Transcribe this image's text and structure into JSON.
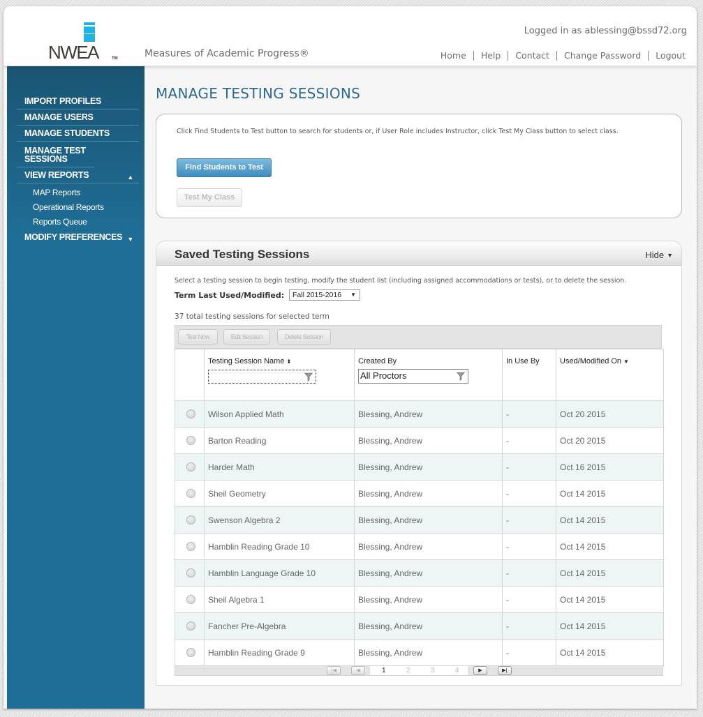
{
  "header": {
    "logo_text": "NWEA",
    "logo_tm": "TM",
    "app_title": "Measures of Academic Progress®",
    "logged_in": "Logged in as ablessing@bssd72.org",
    "nav": [
      "Home",
      "Help",
      "Contact",
      "Change Password",
      "Logout"
    ]
  },
  "sidebar": {
    "items": [
      {
        "label": "IMPORT PROFILES"
      },
      {
        "label": "MANAGE USERS"
      },
      {
        "label": "MANAGE STUDENTS"
      },
      {
        "label": "MANAGE TEST SESSIONS"
      },
      {
        "label": "VIEW REPORTS",
        "expanded": true
      },
      {
        "label": "MODIFY PREFERENCES",
        "expanded": false
      }
    ],
    "sub_items": [
      "MAP Reports",
      "Operational Reports",
      "Reports Queue"
    ],
    "colors": {
      "top": "#1a5573",
      "bottom": "#1f6e97"
    }
  },
  "main": {
    "page_title": "MANAGE TESTING SESSIONS",
    "instructions": "Click Find Students to Test button to search for students or, if User Role includes Instructor, click Test My Class button to select class.",
    "find_button": "Find Students to Test",
    "test_my_class_button": "Test My Class",
    "accent_color": "#3f8dbd"
  },
  "saved": {
    "title": "Saved Testing Sessions",
    "hide_label": "Hide",
    "instructions": "Select a testing session to begin testing, modify the student list (including assigned accommodations or tests), or to delete the session.",
    "term_label": "Term Last Used/Modified:",
    "term_value": "Fall 2015-2016",
    "total_text": "37 total testing sessions for selected term",
    "toolbar": {
      "test_now": "Test Now",
      "edit_session": "Edit Session",
      "delete_session": "Delete Session"
    },
    "columns": [
      "Testing Session Name",
      "Created By",
      "In Use By",
      "Used/Modified On"
    ],
    "name_filter_value": "",
    "created_by_filter": "All Proctors",
    "rows": [
      {
        "name": "Wilson Applied Math",
        "created_by": "Blessing, Andrew",
        "in_use_by": "-",
        "modified": "Oct 20 2015"
      },
      {
        "name": "Barton Reading",
        "created_by": "Blessing, Andrew",
        "in_use_by": "-",
        "modified": "Oct 20 2015"
      },
      {
        "name": "Harder Math",
        "created_by": "Blessing, Andrew",
        "in_use_by": "-",
        "modified": "Oct 16 2015"
      },
      {
        "name": "Sheil Geometry",
        "created_by": "Blessing, Andrew",
        "in_use_by": "-",
        "modified": "Oct 14 2015"
      },
      {
        "name": "Swenson Algebra 2",
        "created_by": "Blessing, Andrew",
        "in_use_by": "-",
        "modified": "Oct 14 2015"
      },
      {
        "name": "Hamblin Reading Grade 10",
        "created_by": "Blessing, Andrew",
        "in_use_by": "-",
        "modified": "Oct 14 2015"
      },
      {
        "name": "Hamblin Language Grade 10",
        "created_by": "Blessing, Andrew",
        "in_use_by": "-",
        "modified": "Oct 14 2015"
      },
      {
        "name": "Sheil Algebra 1",
        "created_by": "Blessing, Andrew",
        "in_use_by": "-",
        "modified": "Oct 14 2015"
      },
      {
        "name": "Fancher Pre-Algebra",
        "created_by": "Blessing, Andrew",
        "in_use_by": "-",
        "modified": "Oct 14 2015"
      },
      {
        "name": "Hamblin Reading Grade 9",
        "created_by": "Blessing, Andrew",
        "in_use_by": "-",
        "modified": "Oct 14 2015"
      }
    ],
    "pager": {
      "pages": [
        "1",
        "2",
        "3",
        "4"
      ],
      "current": "1"
    }
  }
}
